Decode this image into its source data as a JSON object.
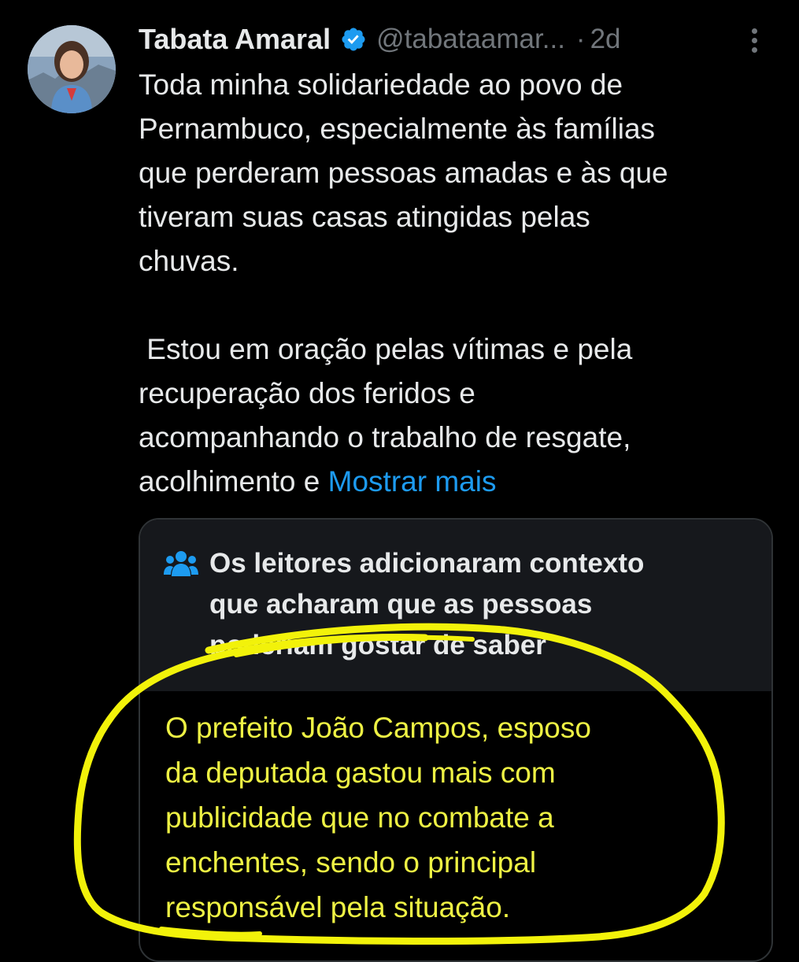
{
  "tweet": {
    "author_name": "Tabata Amaral",
    "handle": "@tabataamar...",
    "separator": "·",
    "time": "2d",
    "verified_color": "#1d9bf0",
    "body_paragraph_1": [
      "Toda minha solidariedade ao povo de",
      "Pernambuco, especialmente às famílias",
      "que perderam pessoas amadas e às que",
      "tiveram suas casas atingidas pelas",
      "chuvas."
    ],
    "body_paragraph_2": [
      " Estou em oração pelas vítimas e pela",
      "recuperação dos feridos e",
      "acompanhando o trabalho de resgate,"
    ],
    "body_last_line_prefix": "acolhimento e ",
    "show_more_label": "Mostrar mais",
    "link_color": "#1d9bf0"
  },
  "community_note": {
    "icon": "people-icon",
    "title_lines": [
      "Os leitores adicionaram contexto",
      "que acharam que as pessoas",
      "poderiam gostar de saber"
    ],
    "body_lines": [
      "O prefeito João Campos, esposo",
      "da deputada gastou mais com",
      "publicidade que no combate a",
      "enchentes, sendo o principal",
      "responsável pela situação."
    ],
    "text_color": "#eef244"
  },
  "annotation": {
    "color": "#f2f20a"
  }
}
